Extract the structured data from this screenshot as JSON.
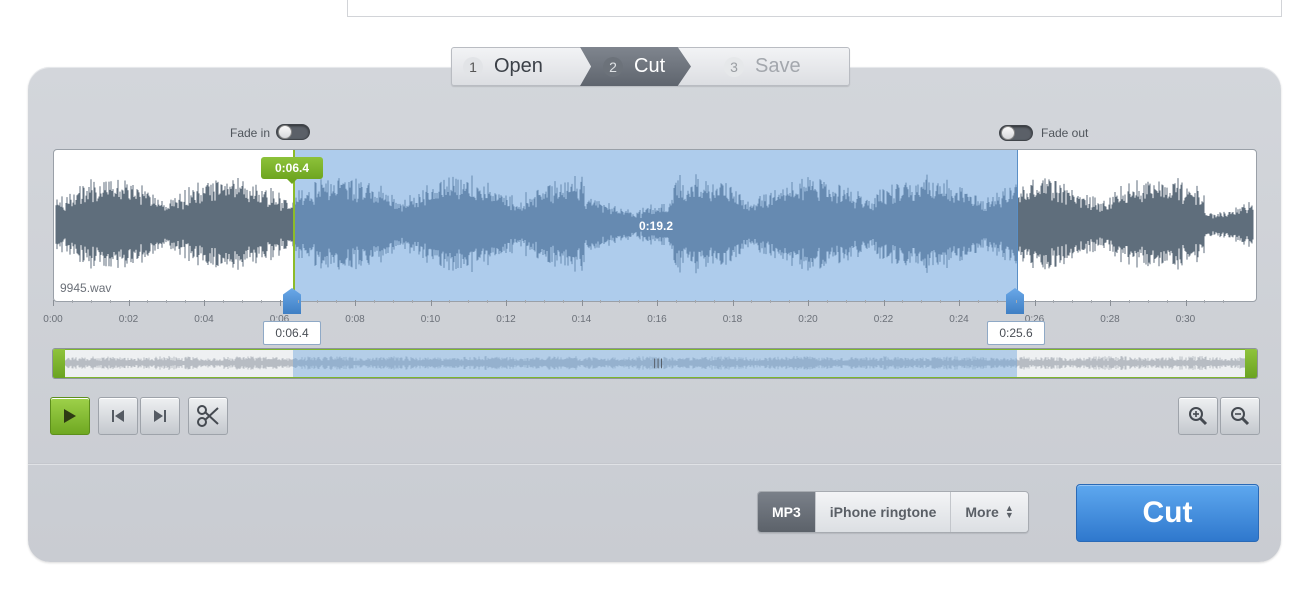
{
  "steps": [
    {
      "num": "1",
      "label": "Open",
      "state": "done"
    },
    {
      "num": "2",
      "label": "Cut",
      "state": "active"
    },
    {
      "num": "3",
      "label": "Save",
      "state": "pending"
    }
  ],
  "fade": {
    "in_label": "Fade in",
    "out_label": "Fade out",
    "in_on": false,
    "out_on": false
  },
  "editor": {
    "file_name": "9945.wav",
    "selection_start": "0:06.4",
    "selection_end": "0:25.6",
    "selection_duration": "0:19.2",
    "total_seconds": 31.8
  },
  "ruler": {
    "labels": [
      "0:00",
      "0:02",
      "0:04",
      "0:06",
      "0:08",
      "0:10",
      "0:12",
      "0:14",
      "0:16",
      "0:18",
      "0:20",
      "0:22",
      "0:24",
      "0:26",
      "0:28",
      "0:30"
    ]
  },
  "controls": {
    "play_icon": "play-icon",
    "prev_icon": "skip-back-icon",
    "next_icon": "skip-forward-icon",
    "cut_icon": "scissors-icon",
    "zoom_in_icon": "zoom-in-icon",
    "zoom_out_icon": "zoom-out-icon"
  },
  "formats": {
    "items": [
      "MP3",
      "iPhone ringtone",
      "More"
    ],
    "selected": "MP3"
  },
  "cut_button_label": "Cut",
  "colors": {
    "accent_blue": "#3f84d6",
    "accent_green": "#7cb32b",
    "waveform": "#5f6e7c",
    "selection": "#6ca3dc"
  }
}
